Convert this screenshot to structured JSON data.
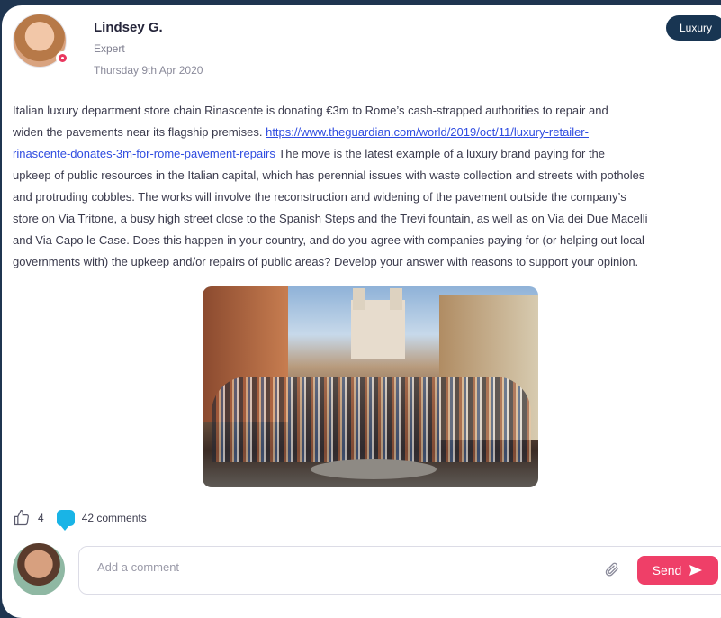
{
  "post": {
    "author": "Lindsey G.",
    "role": "Expert",
    "date": "Thursday 9th Apr 2020",
    "tag": "Luxury",
    "lines": [
      "Italian luxury department store chain Rinascente is donating €3m to Rome’s cash-strapped authorities to repair and",
      "widen the pavements near its flagship premises. ",
      "https://www.theguardian.com/world/2019/oct/11/luxury-retailer-",
      "rinascente-donates-3m-for-rome-pavement-repairs",
      " The move is the latest example of a luxury brand paying for the",
      "upkeep of public resources in the Italian capital, which has perennial issues with waste collection and streets with potholes",
      "and protruding cobbles. The works will involve the reconstruction and widening of the pavement outside the company’s",
      "store on Via Tritone, a busy high street close to the Spanish Steps and the Trevi fountain, as well as on Via dei Due Macelli",
      "and Via Capo le Case. Does this happen in your country, and do you agree with companies paying for (or helping out local",
      "governments with) the upkeep and/or repairs of public areas? Develop your answer with reasons to support your opinion."
    ],
    "likes": "4",
    "comments": "42 comments"
  },
  "composer": {
    "placeholder": "Add a comment",
    "send_label": "Send"
  },
  "icons": {
    "like": "thumbs-up-icon",
    "comment": "comment-bubble-icon",
    "attach": "paperclip-icon",
    "send": "send-arrow-icon"
  },
  "colors": {
    "accent": "#ef3f68",
    "tag_bg": "#183552",
    "link": "#2f4ce0",
    "comment_icon": "#19b4e6"
  }
}
